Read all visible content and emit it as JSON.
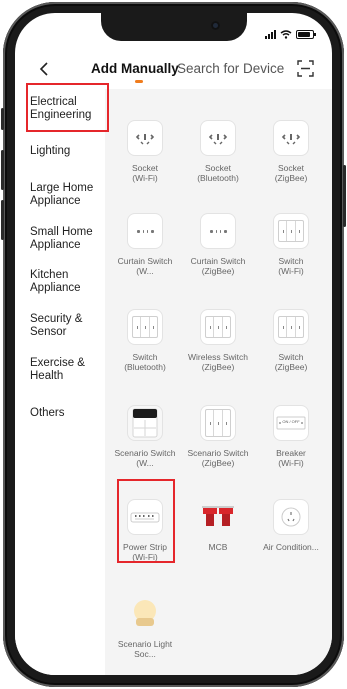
{
  "status_bar": {
    "battery_level": 0.85
  },
  "header": {
    "tab_manual": "Add Manually",
    "tab_search": "Search for Device",
    "accent_color": "#f07c1d"
  },
  "sidebar": {
    "items": [
      {
        "label": "Electrical Engineering",
        "selected": true
      },
      {
        "label": "Lighting"
      },
      {
        "label": "Large Home Appliance"
      },
      {
        "label": "Small Home Appliance"
      },
      {
        "label": "Kitchen Appliance"
      },
      {
        "label": "Security & Sensor"
      },
      {
        "label": "Exercise & Health"
      },
      {
        "label": "Others"
      }
    ]
  },
  "devices": [
    {
      "label": "Socket",
      "sub": "(Wi-Fi)",
      "icon": "socket-icon"
    },
    {
      "label": "Socket",
      "sub": "(Bluetooth)",
      "icon": "socket-icon"
    },
    {
      "label": "Socket",
      "sub": "(ZigBee)",
      "icon": "socket-icon"
    },
    {
      "label": "Curtain Switch (W...",
      "sub": "",
      "icon": "curtain-switch-icon"
    },
    {
      "label": "Curtain Switch",
      "sub": "(ZigBee)",
      "icon": "curtain-switch-icon"
    },
    {
      "label": "Switch",
      "sub": "(Wi-Fi)",
      "icon": "wall-switch-icon"
    },
    {
      "label": "Switch",
      "sub": "(Bluetooth)",
      "icon": "wall-switch-icon"
    },
    {
      "label": "Wireless Switch",
      "sub": "(ZigBee)",
      "icon": "wall-switch-icon"
    },
    {
      "label": "Switch",
      "sub": "(ZigBee)",
      "icon": "wall-switch-icon"
    },
    {
      "label": "Scenario Switch (W...",
      "sub": "",
      "icon": "scenario-switch-icon"
    },
    {
      "label": "Scenario Switch",
      "sub": "(ZigBee)",
      "icon": "scenario-switch-icon"
    },
    {
      "label": "Breaker",
      "sub": "(Wi-Fi)",
      "icon": "breaker-icon",
      "mini_text": "ON / OFF"
    },
    {
      "label": "Power Strip",
      "sub": "(Wi-Fi)",
      "icon": "power-strip-icon"
    },
    {
      "label": "MCB",
      "sub": "",
      "icon": "mcb-icon"
    },
    {
      "label": "Air Condition...",
      "sub": "",
      "icon": "air-condition-socket-icon"
    },
    {
      "label": "Scenario Light Soc...",
      "sub": "",
      "icon": "light-socket-icon"
    }
  ],
  "highlight_color": "#e5262b"
}
